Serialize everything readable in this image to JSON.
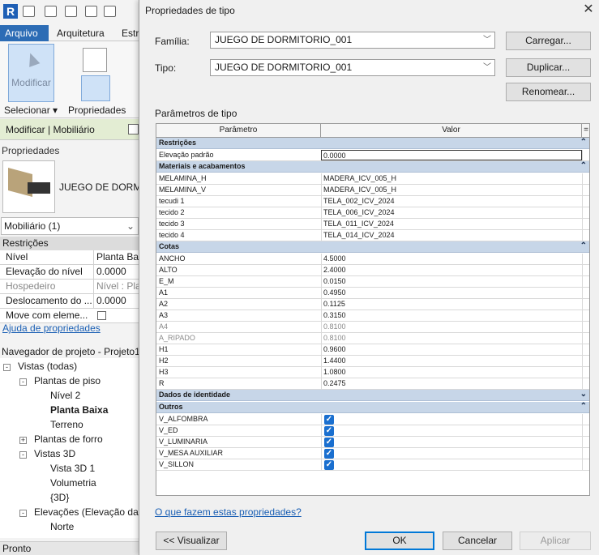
{
  "app": {
    "ribbon_tabs": [
      "Arquivo",
      "Arquitetura",
      "Estr"
    ],
    "modify_button": "Modificar",
    "select_label": "Selecionar ▾",
    "properties_label": "Propriedades",
    "context_bar": "Modificar | Mobiliário"
  },
  "properties_panel": {
    "title": "Propriedades",
    "type_name": "JUEGO DE DORMITO",
    "instance_filter": "Mobiliário (1)",
    "group": "Restrições",
    "rows": [
      {
        "label": "Nível",
        "value": "Planta Baixa",
        "dim": false
      },
      {
        "label": "Elevação do nível",
        "value": "0.0000",
        "dim": false
      },
      {
        "label": "Hospedeiro",
        "value": "Nível : Planta",
        "dim": true
      },
      {
        "label": "Deslocamento do ...",
        "value": "0.0000",
        "dim": false
      },
      {
        "label": "Move com eleme...",
        "value": "",
        "dim": false
      }
    ],
    "help_link": "Ajuda de propriedades"
  },
  "project_browser": {
    "title": "Navegador de projeto - Projeto1",
    "nodes": [
      {
        "label": "Vistas (todas)",
        "level": 0,
        "toggle": "-"
      },
      {
        "label": "Plantas de piso",
        "level": 1,
        "toggle": "-"
      },
      {
        "label": "Nível 2",
        "level": 2,
        "toggle": ""
      },
      {
        "label": "Planta Baixa",
        "level": 2,
        "toggle": "",
        "bold": true
      },
      {
        "label": "Terreno",
        "level": 2,
        "toggle": ""
      },
      {
        "label": "Plantas de forro",
        "level": 1,
        "toggle": "+"
      },
      {
        "label": "Vistas 3D",
        "level": 1,
        "toggle": "-"
      },
      {
        "label": "Vista 3D 1",
        "level": 2,
        "toggle": ""
      },
      {
        "label": "Volumetria",
        "level": 2,
        "toggle": ""
      },
      {
        "label": "{3D}",
        "level": 2,
        "toggle": ""
      },
      {
        "label": "Elevações (Elevação da",
        "level": 1,
        "toggle": "-"
      },
      {
        "label": "Norte",
        "level": 2,
        "toggle": ""
      }
    ]
  },
  "status": "Pronto",
  "dialog": {
    "title": "Propriedades de tipo",
    "family_label": "Família:",
    "family_value": "JUEGO DE DORMITORIO_001",
    "type_label": "Tipo:",
    "type_value": "JUEGO DE DORMITORIO_001",
    "load_button": "Carregar...",
    "duplicate_button": "Duplicar...",
    "rename_button": "Renomear...",
    "params_label": "Parâmetros de tipo",
    "col_param": "Parâmetro",
    "col_value": "Valor",
    "col_extra": "=",
    "groups": [
      {
        "name": "Restrições",
        "arrow": "⌃",
        "rows": [
          {
            "p": "Elevação padrão",
            "v": "0.0000",
            "editing": true
          }
        ]
      },
      {
        "name": "Materiais e acabamentos",
        "arrow": "⌃",
        "rows": [
          {
            "p": "MELAMINA_H",
            "v": "MADERA_ICV_005_H"
          },
          {
            "p": "MELAMINA_V",
            "v": "MADERA_ICV_005_H"
          },
          {
            "p": "tecudi 1",
            "v": "TELA_002_ICV_2024"
          },
          {
            "p": "tecido 2",
            "v": "TELA_006_ICV_2024"
          },
          {
            "p": "tecido 3",
            "v": "TELA_011_ICV_2024"
          },
          {
            "p": "tecido 4",
            "v": "TELA_014_ICV_2024"
          }
        ]
      },
      {
        "name": "Cotas",
        "arrow": "⌃",
        "rows": [
          {
            "p": "ANCHO",
            "v": "4.5000"
          },
          {
            "p": "ALTO",
            "v": "2.4000"
          },
          {
            "p": "E_M",
            "v": "0.0150"
          },
          {
            "p": "A1",
            "v": "0.4950"
          },
          {
            "p": "A2",
            "v": "0.1125"
          },
          {
            "p": "A3",
            "v": "0.3150"
          },
          {
            "p": "A4",
            "v": "0.8100",
            "dim": true
          },
          {
            "p": "A_RIPADO",
            "v": "0.8100",
            "dim": true
          },
          {
            "p": "H1",
            "v": "0.9600"
          },
          {
            "p": "H2",
            "v": "1.4400"
          },
          {
            "p": "H3",
            "v": "1.0800"
          },
          {
            "p": "R",
            "v": "0.2475"
          }
        ]
      },
      {
        "name": "Dados de identidade",
        "arrow": "⌄",
        "rows": []
      },
      {
        "name": "Outros",
        "arrow": "⌃",
        "rows": [
          {
            "p": "V_ALFOMBRA",
            "check": true
          },
          {
            "p": "V_ED",
            "check": true
          },
          {
            "p": "V_LUMINARIA",
            "check": true
          },
          {
            "p": "V_MESA AUXILIAR",
            "check": true
          },
          {
            "p": "V_SILLON",
            "check": true
          }
        ]
      }
    ],
    "help_link": "O que fazem estas propriedades?",
    "preview_button": "<< Visualizar",
    "ok_button": "OK",
    "cancel_button": "Cancelar",
    "apply_button": "Aplicar"
  }
}
